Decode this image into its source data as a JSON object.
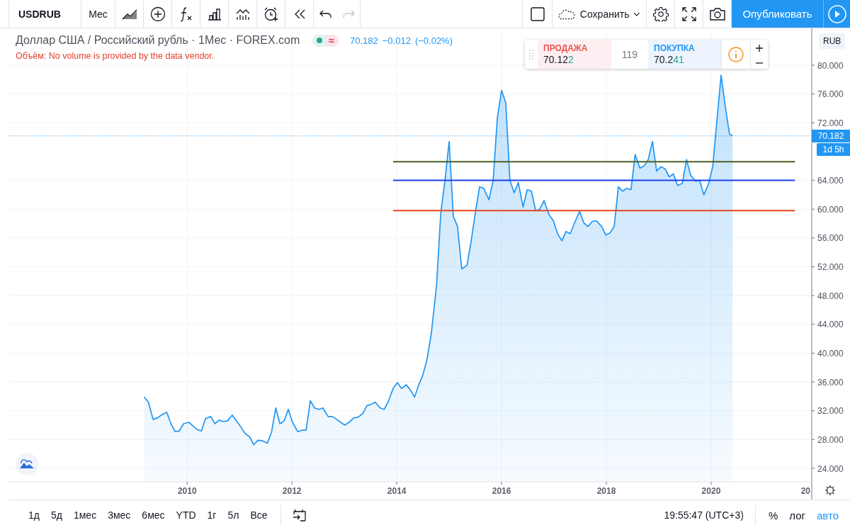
{
  "toolbar": {
    "symbol": "USDRUB",
    "interval": "Мес",
    "undo": {
      "disabled": false
    },
    "redo": {
      "disabled": true
    },
    "save_label": "Сохранить",
    "publish_label": "Опубликовать"
  },
  "legend": {
    "title": "Доллар США / Российский рубль · 1Мес · FOREX.com",
    "market_open": true,
    "delayed_mark": "≈",
    "price": "70.182",
    "change": "−0.012",
    "change_pct": "(−0.02%)",
    "volume_note": "Объём: No volume is provided by the data vendor."
  },
  "trade": {
    "sell_label": "ПРОДАЖА",
    "sell_price": "70.12",
    "sell_price_tail": "2",
    "spread": "119",
    "buy_label": "ПОКУПКА",
    "buy_price": "70.2",
    "buy_price_tail": "41"
  },
  "price_axis": {
    "currency": "RUB",
    "last_price": "70.182",
    "countdown": "1d 5h"
  },
  "chart": {
    "cut_tick_label": "20",
    "chart_data": {
      "type": "area",
      "grid": true,
      "x": [
        2006.59,
        2009.18,
        2009.26,
        2009.35,
        2009.43,
        2009.51,
        2009.61,
        2009.69,
        2009.77,
        2009.85,
        2009.93,
        2010.03,
        2010.11,
        2010.19,
        2010.27,
        2010.35,
        2010.45,
        2010.53,
        2010.61,
        2010.69,
        2010.77,
        2010.86,
        2010.95,
        2011.03,
        2011.11,
        2011.19,
        2011.27,
        2011.35,
        2011.45,
        2011.53,
        2011.61,
        2011.69,
        2011.77,
        2011.85,
        2011.93,
        2012.01,
        2012.11,
        2012.19,
        2012.27,
        2012.35,
        2012.43,
        2012.51,
        2012.59,
        2012.69,
        2012.77,
        2012.85,
        2012.93,
        2013.01,
        2013.09,
        2013.18,
        2013.26,
        2013.35,
        2013.43,
        2013.51,
        2013.59,
        2013.68,
        2013.76,
        2013.84,
        2013.93,
        2014.01,
        2014.09,
        2014.18,
        2014.26,
        2014.34,
        2014.42,
        2014.5,
        2014.58,
        2014.66,
        2014.76,
        2014.84,
        2014.92,
        2015.0,
        2015.08,
        2015.16,
        2015.24,
        2015.34,
        2015.42,
        2015.5,
        2015.58,
        2015.66,
        2015.76,
        2015.84,
        2015.92,
        2016.0,
        2016.08,
        2016.16,
        2016.24,
        2016.32,
        2016.41,
        2016.49,
        2016.57,
        2016.65,
        2016.73,
        2016.81,
        2016.91,
        2016.99,
        2017.07,
        2017.15,
        2017.23,
        2017.31,
        2017.41,
        2017.49,
        2017.57,
        2017.65,
        2017.73,
        2017.81,
        2017.91,
        2017.99,
        2018.07,
        2018.15,
        2018.23,
        2018.31,
        2018.39,
        2018.47,
        2018.55,
        2018.64,
        2018.72,
        2018.8,
        2018.88,
        2018.96,
        2019.04,
        2019.12,
        2019.2,
        2019.28,
        2019.36,
        2019.45,
        2019.53,
        2019.61,
        2019.7,
        2019.78,
        2019.86,
        2019.95,
        2020.03,
        2020.11,
        2020.19,
        2020.27,
        2020.35,
        2020.41,
        2021.6,
        2021.92
      ],
      "series": [
        {
          "color": "#2196f3",
          "values": [
            null,
            33.9,
            33.2,
            30.8,
            31.0,
            31.4,
            31.8,
            30.2,
            29.1,
            29.2,
            30.2,
            30.4,
            29.9,
            29.4,
            29.2,
            30.9,
            31.2,
            30.2,
            30.7,
            30.5,
            30.6,
            31.4,
            30.5,
            29.7,
            28.8,
            28.4,
            27.3,
            27.9,
            27.8,
            27.5,
            29.0,
            32.4,
            30.2,
            30.6,
            32.2,
            30.4,
            29.1,
            29.3,
            29.3,
            33.4,
            32.4,
            32.2,
            32.4,
            31.2,
            31.2,
            30.8,
            30.4,
            30.0,
            30.4,
            31.0,
            31.1,
            31.6,
            32.7,
            32.9,
            33.2,
            32.4,
            32.2,
            33.3,
            35.1,
            35.9,
            35.1,
            35.6,
            34.9,
            33.9,
            35.6,
            37.0,
            39.2,
            42.8,
            49.5,
            59.5,
            64.0,
            69.4,
            59.0,
            57.6,
            51.7,
            52.2,
            55.6,
            59.5,
            63.1,
            62.9,
            61.3,
            64.0,
            72.8,
            76.5,
            74.8,
            64.0,
            62.3,
            63.7,
            60.3,
            62.7,
            62.5,
            59.8,
            60.0,
            61.2,
            59.2,
            58.4,
            56.6,
            55.6,
            56.9,
            56.6,
            58.4,
            59.7,
            58.1,
            57.6,
            58.3,
            58.4,
            57.6,
            56.4,
            56.7,
            57.6,
            63.1,
            62.5,
            62.9,
            62.7,
            67.6,
            65.7,
            66.0,
            66.9,
            69.4,
            65.3,
            65.9,
            65.6,
            64.5,
            64.9,
            63.3,
            63.6,
            66.9,
            64.7,
            63.9,
            64.0,
            62.0,
            63.5,
            65.9,
            72.3,
            78.6,
            74.3,
            70.4,
            70.2,
            null,
            null
          ]
        },
        {
          "type": "line",
          "color": "#4b5e24",
          "values": [
            null,
            null,
            null,
            null,
            null,
            null,
            null,
            null,
            null,
            null,
            null,
            null,
            null,
            null,
            null,
            null,
            null,
            null,
            null,
            null,
            null,
            null,
            null,
            null,
            null,
            null,
            null,
            null,
            null,
            null,
            null,
            null,
            null,
            null,
            null,
            null,
            null,
            null,
            null,
            null,
            null,
            null,
            null,
            null,
            null,
            null,
            null,
            null,
            null,
            null,
            null,
            null,
            null,
            null,
            null,
            null,
            null,
            null,
            66.6,
            66.6,
            66.6,
            66.6,
            66.6,
            66.6,
            66.6,
            66.6,
            66.6,
            66.6,
            66.6,
            66.6,
            66.6,
            66.6,
            66.6,
            66.6,
            66.6,
            66.6,
            66.6,
            66.6,
            66.6,
            66.6,
            66.6,
            66.6,
            66.6,
            66.6,
            66.6,
            66.6,
            66.6,
            66.6,
            66.6,
            66.6,
            66.6,
            66.6,
            66.6,
            66.6,
            66.6,
            66.6,
            66.6,
            66.6,
            66.6,
            66.6,
            66.6,
            66.6,
            66.6,
            66.6,
            66.6,
            66.6,
            66.6,
            66.6,
            66.6,
            66.6,
            66.6,
            66.6,
            66.6,
            66.6,
            66.6,
            66.6,
            66.6,
            66.6,
            66.6,
            66.6,
            66.6,
            66.6,
            66.6,
            66.6,
            66.6,
            66.6,
            66.6,
            66.6,
            66.6,
            66.6,
            66.6,
            66.6,
            66.6,
            66.6,
            66.6,
            66.6,
            66.6,
            66.6,
            66.6,
            null
          ]
        },
        {
          "type": "line",
          "color": "#1f3ff0",
          "values": [
            null,
            null,
            null,
            null,
            null,
            null,
            null,
            null,
            null,
            null,
            null,
            null,
            null,
            null,
            null,
            null,
            null,
            null,
            null,
            null,
            null,
            null,
            null,
            null,
            null,
            null,
            null,
            null,
            null,
            null,
            null,
            null,
            null,
            null,
            null,
            null,
            null,
            null,
            null,
            null,
            null,
            null,
            null,
            null,
            null,
            null,
            null,
            null,
            null,
            null,
            null,
            null,
            null,
            null,
            null,
            null,
            null,
            null,
            64.0,
            64.0,
            64.0,
            64.0,
            64.0,
            64.0,
            64.0,
            64.0,
            64.0,
            64.0,
            64.0,
            64.0,
            64.0,
            64.0,
            64.0,
            64.0,
            64.0,
            64.0,
            64.0,
            64.0,
            64.0,
            64.0,
            64.0,
            64.0,
            64.0,
            64.0,
            64.0,
            64.0,
            64.0,
            64.0,
            64.0,
            64.0,
            64.0,
            64.0,
            64.0,
            64.0,
            64.0,
            64.0,
            64.0,
            64.0,
            64.0,
            64.0,
            64.0,
            64.0,
            64.0,
            64.0,
            64.0,
            64.0,
            64.0,
            64.0,
            64.0,
            64.0,
            64.0,
            64.0,
            64.0,
            64.0,
            64.0,
            64.0,
            64.0,
            64.0,
            64.0,
            64.0,
            64.0,
            64.0,
            64.0,
            64.0,
            64.0,
            64.0,
            64.0,
            64.0,
            64.0,
            64.0,
            64.0,
            64.0,
            64.0,
            64.0,
            64.0,
            64.0,
            64.0,
            64.0,
            64.0,
            null
          ]
        },
        {
          "type": "line",
          "color": "#f0451f",
          "values": [
            null,
            null,
            null,
            null,
            null,
            null,
            null,
            null,
            null,
            null,
            null,
            null,
            null,
            null,
            null,
            null,
            null,
            null,
            null,
            null,
            null,
            null,
            null,
            null,
            null,
            null,
            null,
            null,
            null,
            null,
            null,
            null,
            null,
            null,
            null,
            null,
            null,
            null,
            null,
            null,
            null,
            null,
            null,
            null,
            null,
            null,
            null,
            null,
            null,
            null,
            null,
            null,
            null,
            null,
            null,
            null,
            null,
            null,
            59.8,
            59.8,
            59.8,
            59.8,
            59.8,
            59.8,
            59.8,
            59.8,
            59.8,
            59.8,
            59.8,
            59.8,
            59.8,
            59.8,
            59.8,
            59.8,
            59.8,
            59.8,
            59.8,
            59.8,
            59.8,
            59.8,
            59.8,
            59.8,
            59.8,
            59.8,
            59.8,
            59.8,
            59.8,
            59.8,
            59.8,
            59.8,
            59.8,
            59.8,
            59.8,
            59.8,
            59.8,
            59.8,
            59.8,
            59.8,
            59.8,
            59.8,
            59.8,
            59.8,
            59.8,
            59.8,
            59.8,
            59.8,
            59.8,
            59.8,
            59.8,
            59.8,
            59.8,
            59.8,
            59.8,
            59.8,
            59.8,
            59.8,
            59.8,
            59.8,
            59.8,
            59.8,
            59.8,
            59.8,
            59.8,
            59.8,
            59.8,
            59.8,
            59.8,
            59.8,
            59.8,
            59.8,
            59.8,
            59.8,
            59.8,
            59.8,
            59.8,
            59.8,
            59.8,
            59.8,
            59.8,
            null
          ]
        },
        {
          "type": "line",
          "line_style": "dotted",
          "color": "#2196f3",
          "values": [
            70.182,
            70.182,
            70.182,
            70.182,
            70.182,
            70.182,
            70.182,
            70.182,
            70.182,
            70.182,
            70.182,
            70.182,
            70.182,
            70.182,
            70.182,
            70.182,
            70.182,
            70.182,
            70.182,
            70.182,
            70.182,
            70.182,
            70.182,
            70.182,
            70.182,
            70.182,
            70.182,
            70.182,
            70.182,
            70.182,
            70.182,
            70.182,
            70.182,
            70.182,
            70.182,
            70.182,
            70.182,
            70.182,
            70.182,
            70.182,
            70.182,
            70.182,
            70.182,
            70.182,
            70.182,
            70.182,
            70.182,
            70.182,
            70.182,
            70.182,
            70.182,
            70.182,
            70.182,
            70.182,
            70.182,
            70.182,
            70.182,
            70.182,
            70.182,
            70.182,
            70.182,
            70.182,
            70.182,
            70.182,
            70.182,
            70.182,
            70.182,
            70.182,
            70.182,
            70.182,
            70.182,
            70.182,
            70.182,
            70.182,
            70.182,
            70.182,
            70.182,
            70.182,
            70.182,
            70.182,
            70.182,
            70.182,
            70.182,
            70.182,
            70.182,
            70.182,
            70.182,
            70.182,
            70.182,
            70.182,
            70.182,
            70.182,
            70.182,
            70.182,
            70.182,
            70.182,
            70.182,
            70.182,
            70.182,
            70.182,
            70.182,
            70.182,
            70.182,
            70.182,
            70.182,
            70.182,
            70.182,
            70.182,
            70.182,
            70.182,
            70.182,
            70.182,
            70.182,
            70.182,
            70.182,
            70.182,
            70.182,
            70.182,
            70.182,
            70.182,
            70.182,
            70.182,
            70.182,
            70.182,
            70.182,
            70.182,
            70.182,
            70.182,
            70.182,
            70.182,
            70.182,
            70.182,
            70.182,
            70.182,
            70.182,
            70.182,
            70.182,
            70.182,
            70.182,
            70.182
          ]
        }
      ],
      "xlim": [
        2006.59,
        2021.92
      ],
      "ylim": [
        19.67,
        85.12
      ],
      "xticks": [
        2010,
        2012,
        2014,
        2016,
        2018,
        2020
      ],
      "yticks": [
        {
          "value": 24,
          "label": "24.000"
        },
        {
          "value": 28,
          "label": "28.000"
        },
        {
          "value": 32,
          "label": "32.000"
        },
        {
          "value": 36,
          "label": "36.000"
        },
        {
          "value": 40,
          "label": "40.000"
        },
        {
          "value": 44,
          "label": "44.000"
        },
        {
          "value": 48,
          "label": "48.000"
        },
        {
          "value": 52,
          "label": "52.000"
        },
        {
          "value": 56,
          "label": "56.000"
        },
        {
          "value": 60,
          "label": "60.000"
        },
        {
          "value": 64,
          "label": "64.000"
        },
        {
          "value": 72,
          "label": "72.000"
        },
        {
          "value": 76,
          "label": "76.000"
        },
        {
          "value": 80,
          "label": "80.000"
        }
      ]
    }
  },
  "bottom_bar": {
    "ranges": [
      {
        "label": "1д"
      },
      {
        "label": "5д"
      },
      {
        "label": "1мес"
      },
      {
        "label": "3мес"
      },
      {
        "label": "6мес"
      },
      {
        "label": "YTD"
      },
      {
        "label": "1г"
      },
      {
        "label": "5л"
      },
      {
        "label": "Все"
      }
    ],
    "time": "19:55:47 (UTC+3)",
    "scale_modes": [
      {
        "label": "%",
        "selected": false
      },
      {
        "label": "лог",
        "selected": false
      },
      {
        "label": "авто",
        "selected": true
      }
    ]
  }
}
